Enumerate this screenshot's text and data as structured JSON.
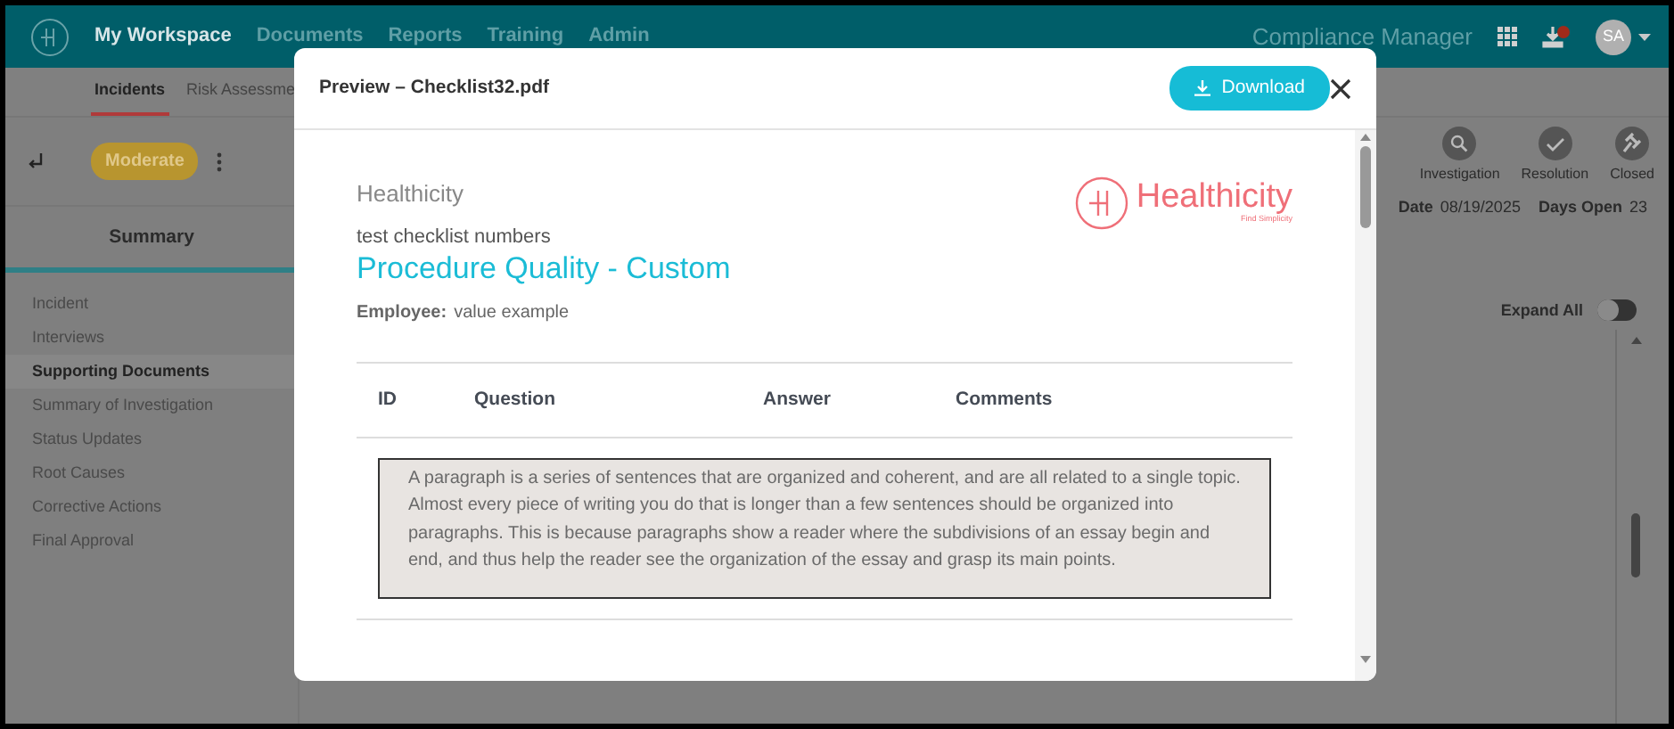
{
  "header": {
    "nav": [
      {
        "label": "My Workspace",
        "selected": true
      },
      {
        "label": "Documents",
        "selected": false
      },
      {
        "label": "Reports",
        "selected": false
      },
      {
        "label": "Training",
        "selected": false
      },
      {
        "label": "Admin",
        "selected": false
      }
    ],
    "app_name": "Compliance Manager",
    "avatar": "SA"
  },
  "subnav": [
    {
      "label": "Incidents",
      "selected": true
    },
    {
      "label": "Risk Assessme",
      "selected": false
    }
  ],
  "left_panel": {
    "severity": "Moderate",
    "tab": "Summary",
    "items": [
      {
        "label": "Incident",
        "selected": false
      },
      {
        "label": "Interviews",
        "selected": false
      },
      {
        "label": "Supporting Documents",
        "selected": true
      },
      {
        "label": "Summary of Investigation",
        "selected": false
      },
      {
        "label": "Status Updates",
        "selected": false
      },
      {
        "label": "Root Causes",
        "selected": false
      },
      {
        "label": "Corrective Actions",
        "selected": false
      },
      {
        "label": "Final Approval",
        "selected": false
      }
    ]
  },
  "progress": {
    "steps": [
      {
        "label": "Investigation",
        "kind": "search"
      },
      {
        "label": "Resolution",
        "kind": "check"
      },
      {
        "label": "Closed",
        "kind": "gavel"
      }
    ]
  },
  "dates": [
    {
      "label": "Date",
      "value": "08/19/2025"
    },
    {
      "label": "Days Open",
      "value": "23"
    }
  ],
  "expand_all": {
    "label": "Expand All",
    "on": false
  },
  "modal": {
    "title": "Preview – Checklist32.pdf",
    "download": "Download",
    "document": {
      "org": "Healthicity",
      "logo_text": "Healthicity",
      "logo_tagline": "Find Simplicity",
      "subtitle": "test checklist numbers",
      "title": "Procedure Quality - Custom",
      "fields": [
        {
          "label": "Employee:",
          "value": "value example"
        }
      ],
      "columns": [
        "ID",
        "Question",
        "Answer",
        "Comments"
      ],
      "paragraph": "A paragraph is a series of sentences that are organized and coherent, and are all related to a single topic. Almost every piece of writing you do that is longer than a few sentences should be organized into paragraphs. This is because paragraphs show a reader where the subdivisions of an essay begin and end, and thus help the reader see the organization of the essay and grasp its main points."
    }
  }
}
